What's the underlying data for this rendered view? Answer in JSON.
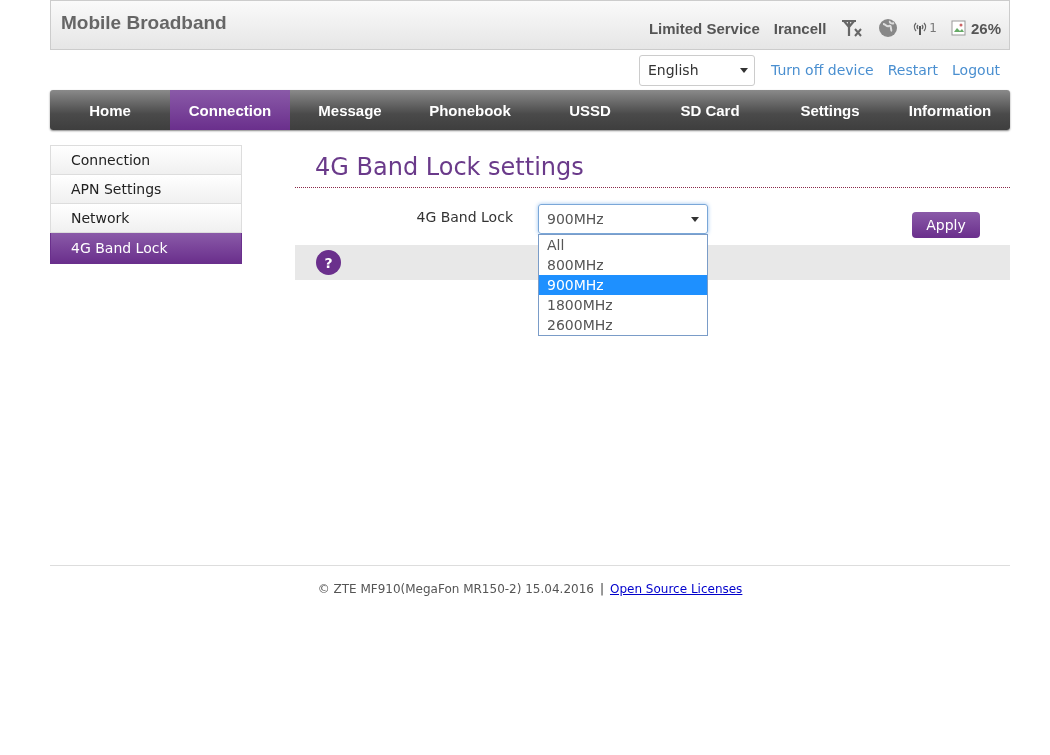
{
  "header": {
    "title": "Mobile Broadband",
    "network_status": "Limited Service",
    "operator": "Irancell",
    "wifi_clients": "1",
    "battery": "26%"
  },
  "toolbar": {
    "language": "English",
    "links": [
      "Turn off device",
      "Restart",
      "Logout"
    ]
  },
  "nav": [
    {
      "label": "Home",
      "selected": false
    },
    {
      "label": "Connection",
      "selected": true
    },
    {
      "label": "Message",
      "selected": false
    },
    {
      "label": "Phonebook",
      "selected": false
    },
    {
      "label": "USSD",
      "selected": false
    },
    {
      "label": "SD Card",
      "selected": false
    },
    {
      "label": "Settings",
      "selected": false
    },
    {
      "label": "Information",
      "selected": false
    }
  ],
  "sidebar": {
    "items": [
      {
        "label": "Connection",
        "selected": false
      },
      {
        "label": "APN Settings",
        "selected": false
      },
      {
        "label": "Network",
        "selected": false
      },
      {
        "label": "4G Band Lock",
        "selected": true
      }
    ]
  },
  "main": {
    "title": "4G Band Lock settings",
    "field_label": "4G Band Lock",
    "value": "900MHz",
    "options": [
      {
        "label": "All",
        "selected": false
      },
      {
        "label": "800MHz",
        "selected": false
      },
      {
        "label": "900MHz",
        "selected": true
      },
      {
        "label": "1800MHz",
        "selected": false
      },
      {
        "label": "2600MHz",
        "selected": false
      }
    ],
    "apply": "Apply",
    "help": "?"
  },
  "footer": {
    "text": "© ZTE MF910(MegaFon MR150-2) 15.04.2016",
    "separator": "|",
    "link": "Open Source Licenses"
  }
}
